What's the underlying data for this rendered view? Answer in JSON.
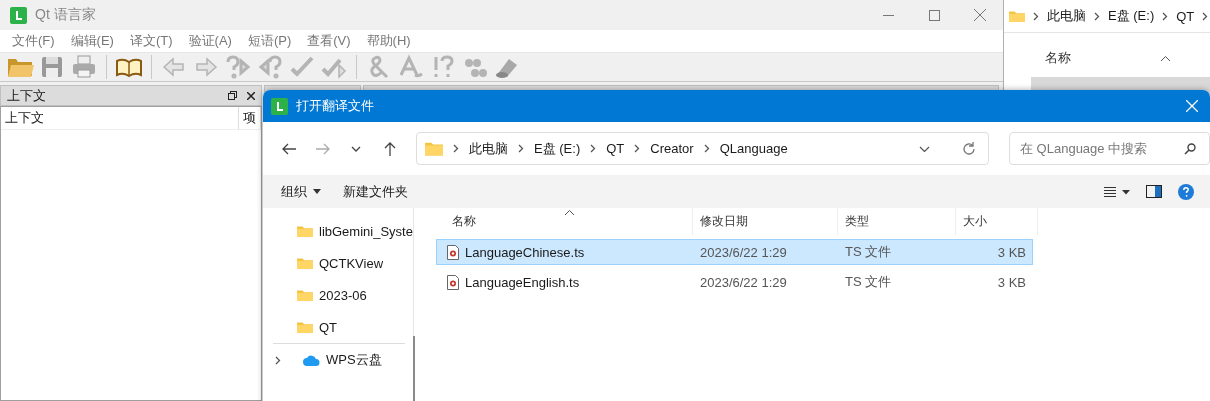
{
  "background_explorer": {
    "breadcrumb": [
      "此电脑",
      "E盘 (E:)",
      "QT"
    ],
    "column_header": "名称"
  },
  "app_window": {
    "title": "Qt 语言家",
    "menu": [
      "文件(F)",
      "编辑(E)",
      "译文(T)",
      "验证(A)",
      "短语(P)",
      "查看(V)",
      "帮助(H)"
    ],
    "context_dock": {
      "title": "上下文",
      "columns": [
        "上下文",
        "项"
      ]
    }
  },
  "dialog": {
    "title": "打开翻译文件",
    "address": [
      "此电脑",
      "E盘 (E:)",
      "QT",
      "Creator",
      "QLanguage"
    ],
    "search": {
      "placeholder": "在 QLanguage 中搜索"
    },
    "commands": [
      {
        "label": "组织",
        "dropdown": true
      },
      {
        "label": "新建文件夹",
        "dropdown": false
      }
    ],
    "nav": [
      {
        "label": "libGemini_Syste",
        "kind": "folder"
      },
      {
        "label": "QCTKView",
        "kind": "folder"
      },
      {
        "label": "2023-06",
        "kind": "folder"
      },
      {
        "label": "QT",
        "kind": "folder"
      },
      {
        "label": "WPS云盘",
        "kind": "cloud"
      }
    ],
    "columns": [
      "名称",
      "修改日期",
      "类型",
      "大小"
    ],
    "files": [
      {
        "name": "LanguageChinese.ts",
        "modified": "2023/6/22 1:29",
        "type": "TS 文件",
        "size": "3 KB",
        "selected": true
      },
      {
        "name": "LanguageEnglish.ts",
        "modified": "2023/6/22 1:29",
        "type": "TS 文件",
        "size": "3 KB",
        "selected": false
      }
    ]
  }
}
